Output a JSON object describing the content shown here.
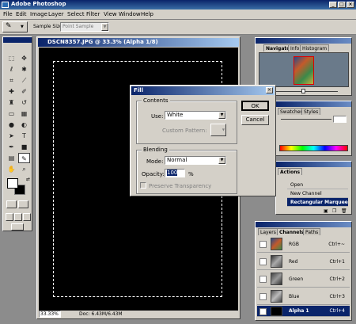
{
  "app": {
    "title": "Adobe Photoshop"
  },
  "menu": [
    "File",
    "Edit",
    "Image",
    "Layer",
    "Select",
    "Filter",
    "View",
    "Window",
    "Help"
  ],
  "options": {
    "sample_size_label": "Sample Size:",
    "sample_size_value": "Point Sample"
  },
  "document": {
    "title": "DSCN8357.JPG @ 33.3% (Alpha 1/8)",
    "zoom": "33.33%",
    "doc_info": "Doc: 6.43M/6.43M"
  },
  "dialog": {
    "title": "Fill",
    "contents_legend": "Contents",
    "use_label": "Use:",
    "use_value": "White",
    "custom_pattern_label": "Custom Pattern:",
    "blending_legend": "Blending",
    "mode_label": "Mode:",
    "mode_value": "Normal",
    "opacity_label": "Opacity:",
    "opacity_value": "100",
    "opacity_unit": "%",
    "preserve_label": "Preserve Transparency",
    "ok": "OK",
    "cancel": "Cancel"
  },
  "navigator": {
    "tabs": [
      "Navigator",
      "Info",
      "Histogram"
    ]
  },
  "color": {
    "tabs": [
      "Swatches",
      "Styles"
    ]
  },
  "actions": {
    "tab": "Actions",
    "items": [
      "Open",
      "New Channel",
      "Rectangular Marquee"
    ]
  },
  "channels": {
    "tabs": [
      "Layers",
      "Channels",
      "Paths"
    ],
    "rows": [
      {
        "name": "RGB",
        "key": "Ctrl+~"
      },
      {
        "name": "Red",
        "key": "Ctrl+1"
      },
      {
        "name": "Green",
        "key": "Ctrl+2"
      },
      {
        "name": "Blue",
        "key": "Ctrl+3"
      },
      {
        "name": "Alpha 1",
        "key": "Ctrl+4"
      }
    ]
  },
  "colors": {
    "accent": "#0a246a",
    "chrome": "#d4d0c8",
    "canvas": "#000000"
  }
}
